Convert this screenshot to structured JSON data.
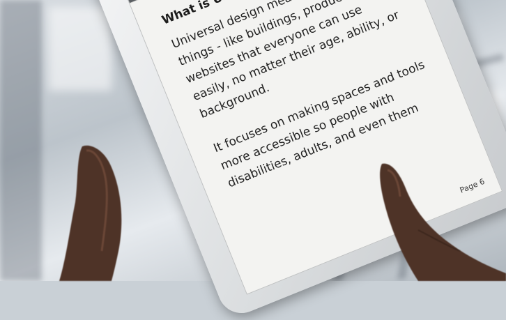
{
  "reader": {
    "toolbar": {
      "menu_icon": "menu-icon",
      "bookmark_icon": "bookmark-icon"
    },
    "title": "What is Universal Design?",
    "paragraphs": [
      "Universal design means creating things - like buildings, products, or websites that everyone can use easily, no matter their age, ability, or background.",
      "It focuses on making spaces and tools more accessible so people with disabilities, adults, and even them"
    ],
    "page_label": "Page 6"
  },
  "colors": {
    "screen": "#f3f3f1",
    "toolbar_icons_bg": "#5b5f63",
    "tablet_bezel": "#e6e8ea",
    "skin": "#5a3a2a"
  }
}
